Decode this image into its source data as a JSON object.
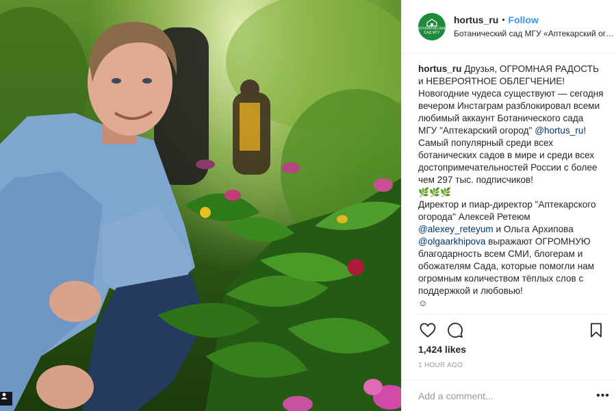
{
  "post": {
    "username": "hortus_ru",
    "separator": "•",
    "follow_label": "Follow",
    "location": "Ботанический сад МГУ «Аптекарский огород»",
    "avatar_text_1": "БОТАНИЧЕСКИЙ",
    "avatar_text_2": "САД МГУ",
    "caption": {
      "username": "hortus_ru",
      "part1": " Друзья, ОГРОМНАЯ РАДОСТЬ и НЕВЕРОЯТНОЕ ОБЛЕГЧЕНИЕ! Новогодние чудеса существуют — сегодня вечером Инстаграм разблокировал всеми любимый аккаунт Ботанического сада МГУ \"Аптекарский огород\" ",
      "mention1": "@hortus_ru",
      "part2": "! Самый популярный среди всех ботанических садов в мире и среди всех достопримечательностей России с более чем 297 тыс. подписчиков!",
      "emoji_line": "🌿🌿🌿",
      "part3": "Директор и пиар-директор \"Аптекарского огорода\" Алексей Ретеюм ",
      "mention2": "@alexey_reteyum",
      "part4": " и Ольга Архипова ",
      "mention3": "@olgaarkhipova",
      "part5": " выражают ОГРОМНУЮ благодарность всем СМИ, блогерам и обожателям Сада, которые помогли нам огромным количеством тёплых слов с поддержкой и любовью!",
      "emoji_end": "☺"
    },
    "likes": "1,424 likes",
    "time": "1 HOUR AGO",
    "comment_placeholder": "Add a comment...",
    "more_label": "•••"
  },
  "icons": {
    "like": "heart-icon",
    "comment": "comment-icon",
    "save": "bookmark-icon",
    "more": "more-options-icon",
    "tag": "user-tag-icon"
  },
  "colors": {
    "follow": "#3897f0",
    "mention": "#003569",
    "avatar": "#1f8a3c",
    "muted": "#999999"
  }
}
